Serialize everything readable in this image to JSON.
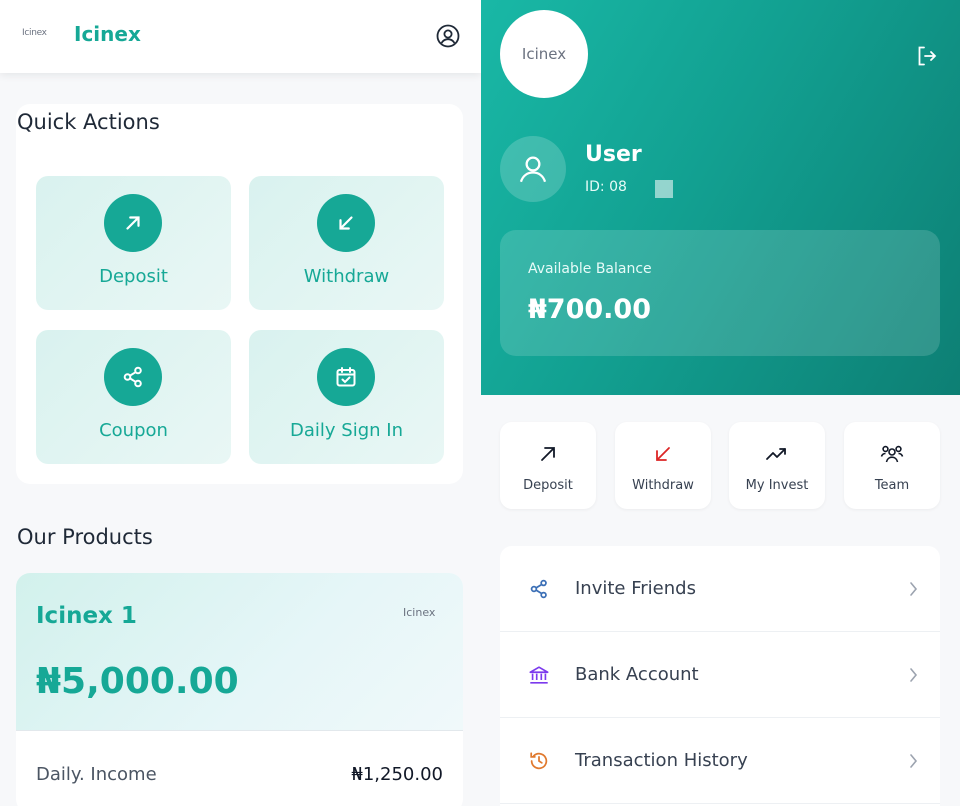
{
  "left": {
    "header": {
      "mini_logo": "Icinex",
      "brand": "Icinex"
    },
    "quick_actions": {
      "title": "Quick Actions",
      "items": [
        {
          "label": "Deposit",
          "icon": "arrow-up-right-icon"
        },
        {
          "label": "Withdraw",
          "icon": "arrow-down-left-icon"
        },
        {
          "label": "Coupon",
          "icon": "share-icon"
        },
        {
          "label": "Daily Sign In",
          "icon": "calendar-check-icon"
        }
      ]
    },
    "products": {
      "title": "Our Products",
      "card": {
        "name": "Icinex 1",
        "mini_logo": "Icinex",
        "price": "₦5,000.00",
        "income_label": "Daily. Income",
        "income_value": "₦1,250.00"
      }
    }
  },
  "right": {
    "hero": {
      "logo": "Icinex",
      "user_name": "User",
      "user_id": "ID: 08",
      "balance_label": "Available Balance",
      "balance_value": "₦700.00"
    },
    "quick_buttons": [
      {
        "label": "Deposit",
        "icon": "arrow-up-right-icon"
      },
      {
        "label": "Withdraw",
        "icon": "arrow-down-left-icon"
      },
      {
        "label": "My Invest",
        "icon": "trending-up-icon"
      },
      {
        "label": "Team",
        "icon": "team-icon"
      }
    ],
    "menu": [
      {
        "label": "Invite Friends",
        "icon": "share-icon"
      },
      {
        "label": "Bank Account",
        "icon": "bank-icon"
      },
      {
        "label": "Transaction History",
        "icon": "history-icon"
      }
    ]
  },
  "colors": {
    "accent": "#16a896",
    "hero_start": "#19b8a6",
    "hero_end": "#0d7f74",
    "withdraw_red": "#dc2626",
    "invite_blue": "#3b6fb6",
    "bank_purple": "#7c3aed",
    "history_orange": "#e0792e"
  }
}
